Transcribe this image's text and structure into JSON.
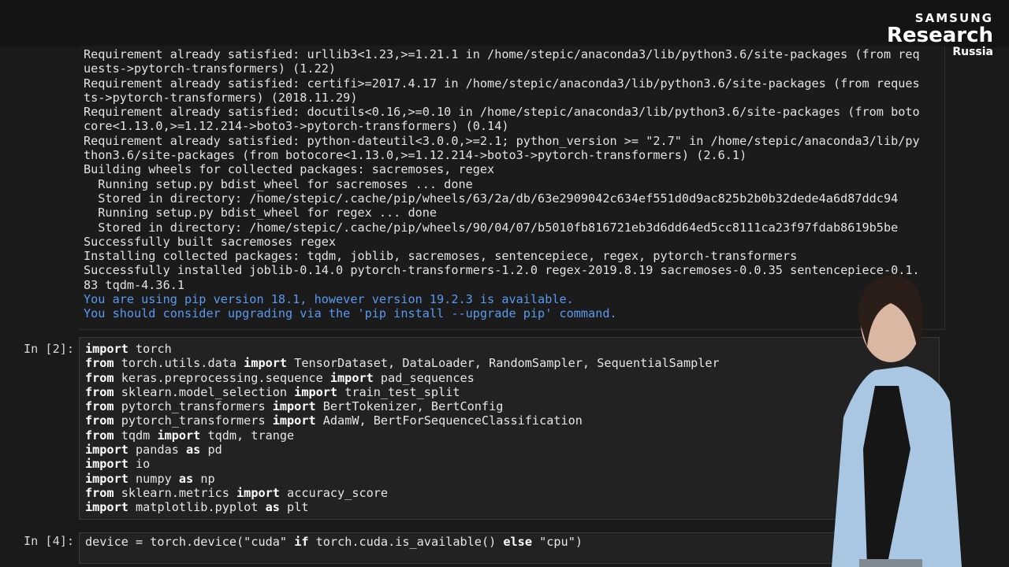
{
  "logo": {
    "brand": "SAMSUNG",
    "main": "Research",
    "sub": "Russia"
  },
  "output_lines": [
    "Requirement already satisfied: urllib3<1.23,>=1.21.1 in /home/stepic/anaconda3/lib/python3.6/site-packages (from req",
    "uests->pytorch-transformers) (1.22)",
    "Requirement already satisfied: certifi>=2017.4.17 in /home/stepic/anaconda3/lib/python3.6/site-packages (from reques",
    "ts->pytorch-transformers) (2018.11.29)",
    "Requirement already satisfied: docutils<0.16,>=0.10 in /home/stepic/anaconda3/lib/python3.6/site-packages (from boto",
    "core<1.13.0,>=1.12.214->boto3->pytorch-transformers) (0.14)",
    "Requirement already satisfied: python-dateutil<3.0.0,>=2.1; python_version >= \"2.7\" in /home/stepic/anaconda3/lib/py",
    "thon3.6/site-packages (from botocore<1.13.0,>=1.12.214->boto3->pytorch-transformers) (2.6.1)",
    "Building wheels for collected packages: sacremoses, regex",
    "  Running setup.py bdist_wheel for sacremoses ... done",
    "  Stored in directory: /home/stepic/.cache/pip/wheels/63/2a/db/63e2909042c634ef551d0d9ac825b2b0b32dede4a6d87ddc94",
    "  Running setup.py bdist_wheel for regex ... done",
    "  Stored in directory: /home/stepic/.cache/pip/wheels/90/04/07/b5010fb816721eb3d6dd64ed5cc8111ca23f97fdab8619b5be",
    "Successfully built sacremoses regex",
    "Installing collected packages: tqdm, joblib, sacremoses, sentencepiece, regex, pytorch-transformers",
    "Successfully installed joblib-0.14.0 pytorch-transformers-1.2.0 regex-2019.8.19 sacremoses-0.0.35 sentencepiece-0.1.",
    "83 tqdm-4.36.1"
  ],
  "warning_lines": [
    "You are using pip version 18.1, however version 19.2.3 is available.",
    "You should consider upgrading via the 'pip install --upgrade pip' command."
  ],
  "cell2": {
    "prompt": "In [2]:",
    "lines": [
      [
        [
          "kw",
          "import"
        ],
        [
          "t",
          " torch"
        ]
      ],
      [
        [
          "kw",
          "from"
        ],
        [
          "t",
          " torch.utils.data "
        ],
        [
          "kw",
          "import"
        ],
        [
          "t",
          " TensorDataset, DataLoader, RandomSampler, SequentialSampler"
        ]
      ],
      [
        [
          "kw",
          "from"
        ],
        [
          "t",
          " keras.preprocessing.sequence "
        ],
        [
          "kw",
          "import"
        ],
        [
          "t",
          " pad_sequences"
        ]
      ],
      [
        [
          "kw",
          "from"
        ],
        [
          "t",
          " sklearn.model_selection "
        ],
        [
          "kw",
          "import"
        ],
        [
          "t",
          " train_test_split"
        ]
      ],
      [
        [
          "kw",
          "from"
        ],
        [
          "t",
          " pytorch_transformers "
        ],
        [
          "kw",
          "import"
        ],
        [
          "t",
          " BertTokenizer, BertConfig"
        ]
      ],
      [
        [
          "kw",
          "from"
        ],
        [
          "t",
          " pytorch_transformers "
        ],
        [
          "kw",
          "import"
        ],
        [
          "t",
          " AdamW, BertForSequenceClassification"
        ]
      ],
      [
        [
          "kw",
          "from"
        ],
        [
          "t",
          " tqdm "
        ],
        [
          "kw",
          "import"
        ],
        [
          "t",
          " tqdm, trange"
        ]
      ],
      [
        [
          "kw",
          "import"
        ],
        [
          "t",
          " pandas "
        ],
        [
          "kw",
          "as"
        ],
        [
          "t",
          " pd"
        ]
      ],
      [
        [
          "kw",
          "import"
        ],
        [
          "t",
          " io"
        ]
      ],
      [
        [
          "kw",
          "import"
        ],
        [
          "t",
          " numpy "
        ],
        [
          "kw",
          "as"
        ],
        [
          "t",
          " np"
        ]
      ],
      [
        [
          "kw",
          "from"
        ],
        [
          "t",
          " sklearn.metrics "
        ],
        [
          "kw",
          "import"
        ],
        [
          "t",
          " accuracy_score"
        ]
      ],
      [
        [
          "kw",
          "import"
        ],
        [
          "t",
          " matplotlib.pyplot "
        ],
        [
          "kw",
          "as"
        ],
        [
          "t",
          " plt"
        ]
      ]
    ]
  },
  "cell3": {
    "prompt": "In [4]:",
    "lines": [
      [
        [
          "t",
          "device = torch.device("
        ],
        [
          "str",
          "\"cuda\""
        ],
        [
          "t",
          " "
        ],
        [
          "kw",
          "if"
        ],
        [
          "t",
          " torch.cuda.is_available() "
        ],
        [
          "kw",
          "else"
        ],
        [
          "t",
          " "
        ],
        [
          "str",
          "\"cpu\""
        ],
        [
          "t",
          ")"
        ]
      ]
    ]
  }
}
